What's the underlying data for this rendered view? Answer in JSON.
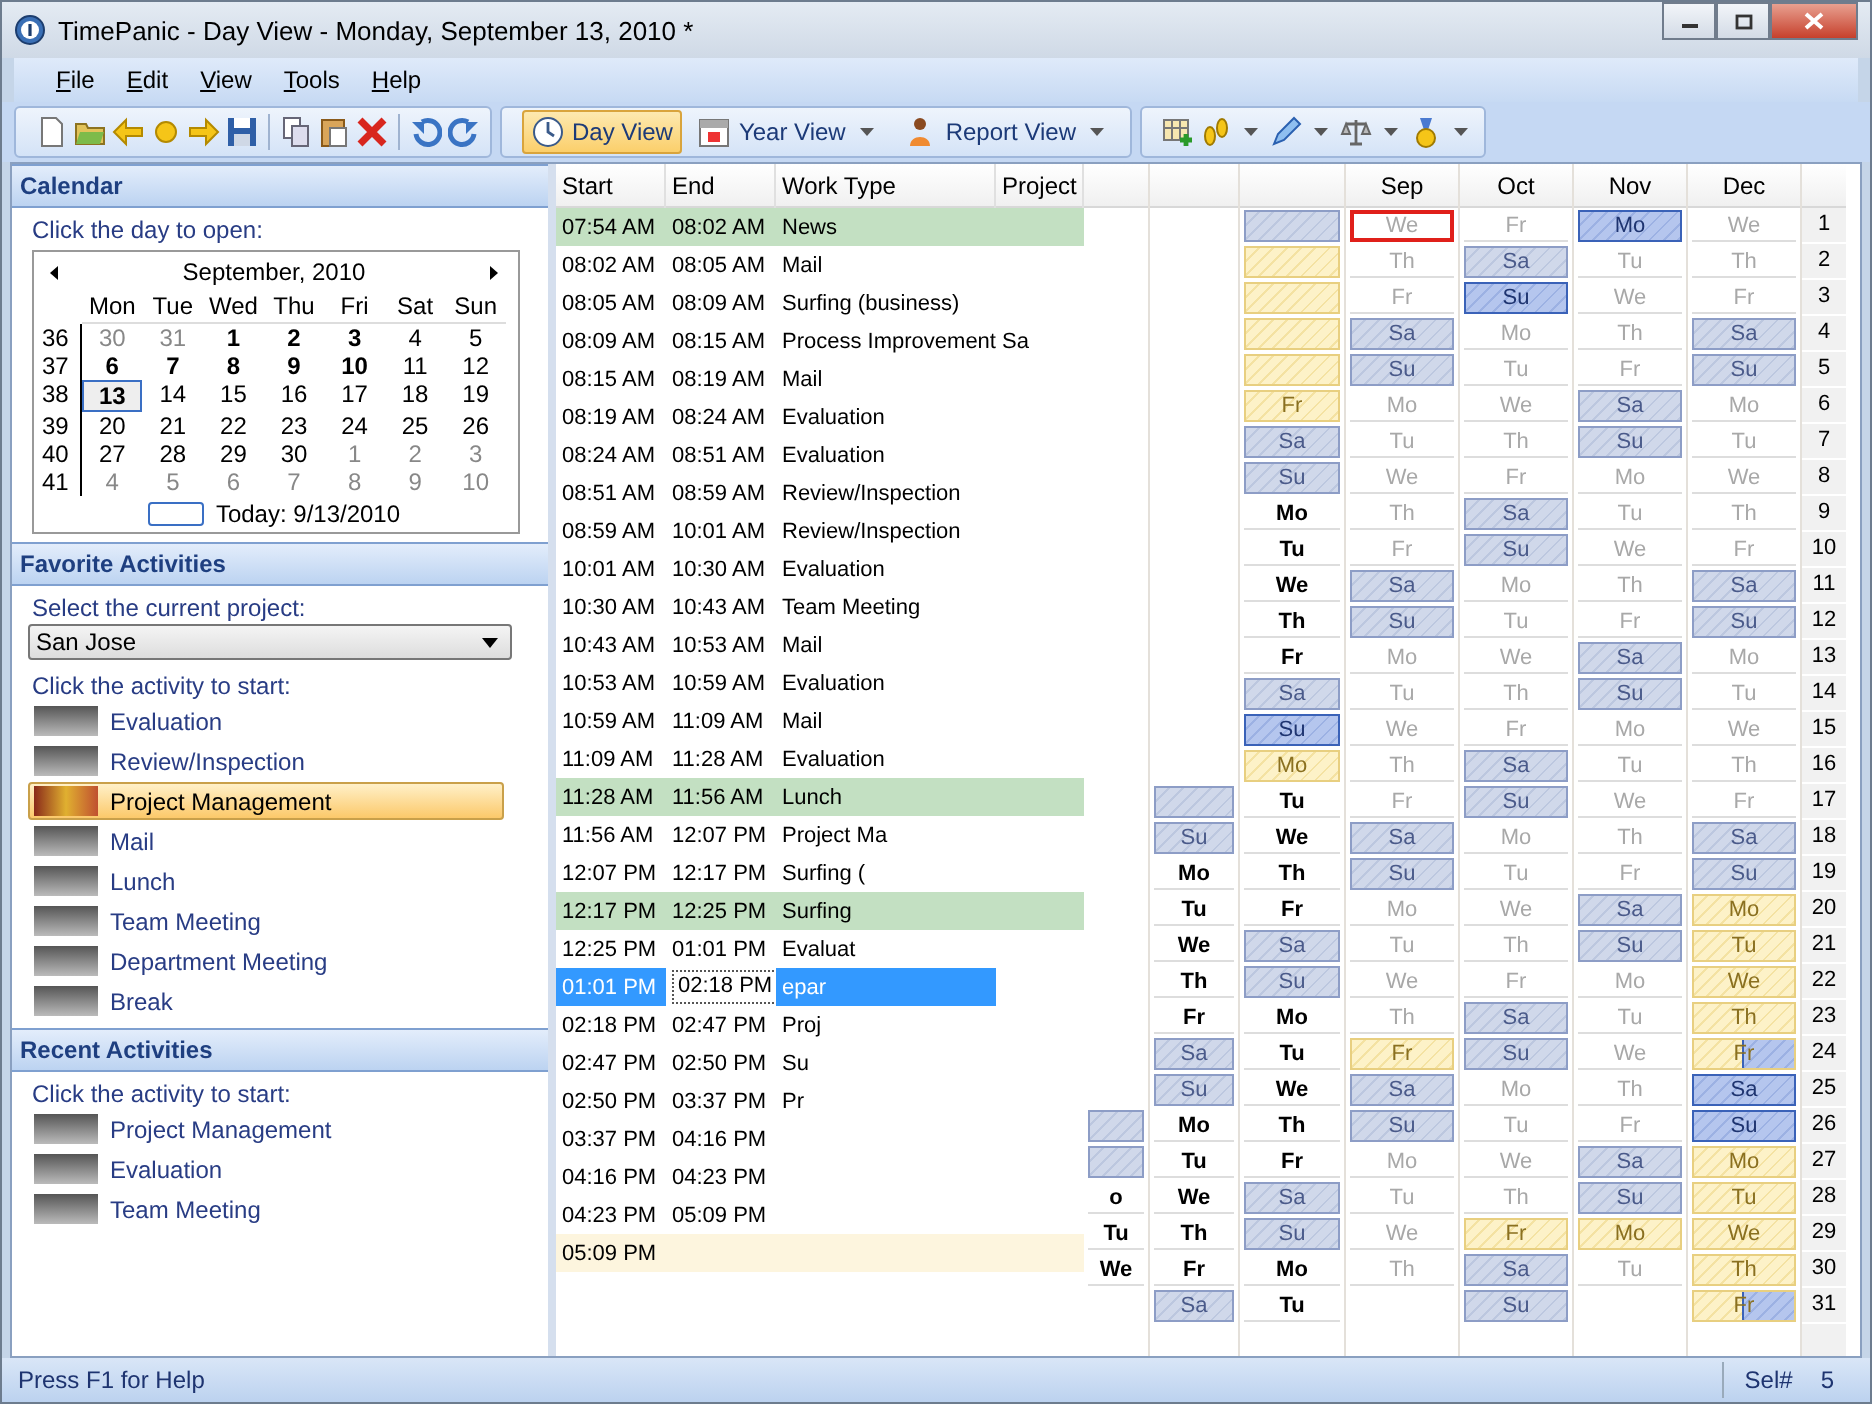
{
  "window": {
    "title": "TimePanic - Day View - Monday, September 13, 2010 *"
  },
  "menu": [
    "File",
    "Edit",
    "View",
    "Tools",
    "Help"
  ],
  "views": [
    {
      "label": "Day View",
      "selected": true,
      "dropdown": false
    },
    {
      "label": "Year View",
      "selected": false,
      "dropdown": true
    },
    {
      "label": "Report View",
      "selected": false,
      "dropdown": true
    }
  ],
  "calendar": {
    "title": "Calendar",
    "prompt": "Click the day to open:",
    "month": "September, 2010",
    "weekdays": [
      "Mon",
      "Tue",
      "Wed",
      "Thu",
      "Fri",
      "Sat",
      "Sun"
    ],
    "weeks": [
      {
        "week": "36",
        "days": [
          {
            "day": "30",
            "kind": "other"
          },
          {
            "day": "31",
            "kind": "other"
          },
          {
            "day": "1",
            "kind": "bold"
          },
          {
            "day": "2",
            "kind": "bold"
          },
          {
            "day": "3",
            "kind": "bold"
          },
          {
            "day": "4",
            "kind": "normal"
          },
          {
            "day": "5",
            "kind": "normal"
          }
        ]
      },
      {
        "week": "37",
        "days": [
          {
            "day": "6",
            "kind": "bold"
          },
          {
            "day": "7",
            "kind": "bold"
          },
          {
            "day": "8",
            "kind": "bold"
          },
          {
            "day": "9",
            "kind": "bold"
          },
          {
            "day": "10",
            "kind": "bold"
          },
          {
            "day": "11",
            "kind": "normal"
          },
          {
            "day": "12",
            "kind": "normal"
          }
        ]
      },
      {
        "week": "38",
        "days": [
          {
            "day": "13",
            "kind": "today"
          },
          {
            "day": "14",
            "kind": "normal"
          },
          {
            "day": "15",
            "kind": "normal"
          },
          {
            "day": "16",
            "kind": "normal"
          },
          {
            "day": "17",
            "kind": "normal"
          },
          {
            "day": "18",
            "kind": "normal"
          },
          {
            "day": "19",
            "kind": "normal"
          }
        ]
      },
      {
        "week": "39",
        "days": [
          {
            "day": "20",
            "kind": "normal"
          },
          {
            "day": "21",
            "kind": "normal"
          },
          {
            "day": "22",
            "kind": "normal"
          },
          {
            "day": "23",
            "kind": "normal"
          },
          {
            "day": "24",
            "kind": "normal"
          },
          {
            "day": "25",
            "kind": "normal"
          },
          {
            "day": "26",
            "kind": "normal"
          }
        ]
      },
      {
        "week": "40",
        "days": [
          {
            "day": "27",
            "kind": "normal"
          },
          {
            "day": "28",
            "kind": "normal"
          },
          {
            "day": "29",
            "kind": "normal"
          },
          {
            "day": "30",
            "kind": "normal"
          },
          {
            "day": "1",
            "kind": "other"
          },
          {
            "day": "2",
            "kind": "other"
          },
          {
            "day": "3",
            "kind": "other"
          }
        ]
      },
      {
        "week": "41",
        "days": [
          {
            "day": "4",
            "kind": "other"
          },
          {
            "day": "5",
            "kind": "other"
          },
          {
            "day": "6",
            "kind": "other"
          },
          {
            "day": "7",
            "kind": "other"
          },
          {
            "day": "8",
            "kind": "other"
          },
          {
            "day": "9",
            "kind": "other"
          },
          {
            "day": "10",
            "kind": "other"
          }
        ]
      }
    ],
    "today": "Today: 9/13/2010"
  },
  "favorites": {
    "title": "Favorite Activities",
    "project_prompt": "Select the current project:",
    "project": "San Jose",
    "activity_prompt": "Click the activity to start:",
    "activities": [
      {
        "label": "Evaluation",
        "selected": false
      },
      {
        "label": "Review/Inspection",
        "selected": false
      },
      {
        "label": "Project Management",
        "selected": true
      },
      {
        "label": "Mail",
        "selected": false
      },
      {
        "label": "Lunch",
        "selected": false
      },
      {
        "label": "Team Meeting",
        "selected": false
      },
      {
        "label": "Department Meeting",
        "selected": false
      },
      {
        "label": "Break",
        "selected": false
      }
    ]
  },
  "recent": {
    "title": "Recent Activities",
    "activity_prompt": "Click the activity to start:",
    "activities": [
      {
        "label": "Project Management",
        "selected": false
      },
      {
        "label": "Evaluation",
        "selected": false
      },
      {
        "label": "Team Meeting",
        "selected": false
      }
    ]
  },
  "day_view": {
    "columns": [
      "Start",
      "End",
      "Work Type",
      "Project"
    ],
    "entries": [
      {
        "start": "07:54 AM",
        "end": "08:02 AM",
        "work_type": "News",
        "kind": "break",
        "selected": false
      },
      {
        "start": "08:02 AM",
        "end": "08:05 AM",
        "work_type": "Mail",
        "kind": "normal",
        "selected": false
      },
      {
        "start": "08:05 AM",
        "end": "08:09 AM",
        "work_type": "Surfing (business)",
        "kind": "normal",
        "selected": false
      },
      {
        "start": "08:09 AM",
        "end": "08:15 AM",
        "work_type": "Process Improvement",
        "project": "Sa",
        "kind": "normal",
        "selected": false
      },
      {
        "start": "08:15 AM",
        "end": "08:19 AM",
        "work_type": "Mail",
        "kind": "normal",
        "selected": false
      },
      {
        "start": "08:19 AM",
        "end": "08:24 AM",
        "work_type": "Evaluation",
        "kind": "normal",
        "selected": false
      },
      {
        "start": "08:24 AM",
        "end": "08:51 AM",
        "work_type": "Evaluation",
        "kind": "normal",
        "selected": false
      },
      {
        "start": "08:51 AM",
        "end": "08:59 AM",
        "work_type": "Review/Inspection",
        "kind": "normal",
        "selected": false
      },
      {
        "start": "08:59 AM",
        "end": "10:01 AM",
        "work_type": "Review/Inspection",
        "kind": "normal",
        "selected": false
      },
      {
        "start": "10:01 AM",
        "end": "10:30 AM",
        "work_type": "Evaluation",
        "kind": "normal",
        "selected": false
      },
      {
        "start": "10:30 AM",
        "end": "10:43 AM",
        "work_type": "Team Meeting",
        "kind": "normal",
        "selected": false
      },
      {
        "start": "10:43 AM",
        "end": "10:53 AM",
        "work_type": "Mail",
        "kind": "normal",
        "selected": false
      },
      {
        "start": "10:53 AM",
        "end": "10:59 AM",
        "work_type": "Evaluation",
        "kind": "normal",
        "selected": false
      },
      {
        "start": "10:59 AM",
        "end": "11:09 AM",
        "work_type": "Mail",
        "kind": "normal",
        "selected": false
      },
      {
        "start": "11:09 AM",
        "end": "11:28 AM",
        "work_type": "Evaluation",
        "kind": "normal",
        "selected": false
      },
      {
        "start": "11:28 AM",
        "end": "11:56 AM",
        "work_type": "Lunch",
        "kind": "break",
        "selected": false
      },
      {
        "start": "11:56 AM",
        "end": "12:07 PM",
        "work_type": "Project Ma",
        "kind": "normal",
        "selected": false
      },
      {
        "start": "12:07 PM",
        "end": "12:17 PM",
        "work_type": "Surfing (",
        "kind": "normal",
        "selected": false
      },
      {
        "start": "12:17 PM",
        "end": "12:25 PM",
        "work_type": "Surfing",
        "kind": "break",
        "selected": false
      },
      {
        "start": "12:25 PM",
        "end": "01:01 PM",
        "work_type": "Evaluat",
        "kind": "normal",
        "selected": false
      },
      {
        "start": "01:01 PM",
        "end": "02:18 PM",
        "work_type": "epar",
        "kind": "normal",
        "selected": true
      },
      {
        "start": "02:18 PM",
        "end": "02:47 PM",
        "work_type": "Proj",
        "kind": "normal",
        "selected": false
      },
      {
        "start": "02:47 PM",
        "end": "02:50 PM",
        "work_type": "Su",
        "kind": "normal",
        "selected": false
      },
      {
        "start": "02:50 PM",
        "end": "03:37 PM",
        "work_type": "Pr",
        "kind": "normal",
        "selected": false
      },
      {
        "start": "03:37 PM",
        "end": "04:16 PM",
        "kind": "normal",
        "selected": false
      },
      {
        "start": "04:16 PM",
        "end": "04:23 PM",
        "kind": "normal",
        "selected": false
      },
      {
        "start": "04:23 PM",
        "end": "05:09 PM",
        "kind": "normal",
        "selected": false
      },
      {
        "start": "05:09 PM",
        "kind": "running",
        "selected": false
      }
    ]
  },
  "year_view": {
    "months": [
      {
        "cells": [
          null,
          null,
          null,
          null,
          null,
          null,
          null,
          null,
          null,
          null,
          null,
          null,
          null,
          null,
          null,
          null,
          null,
          null,
          null,
          null,
          null,
          null,
          null,
          null,
          null,
          {
            "kind": "weekend"
          },
          {
            "kind": "weekend"
          },
          {
            "day": "o",
            "kind": "bold"
          },
          {
            "day": "Tu",
            "kind": "bold"
          },
          {
            "day": "We",
            "kind": "bold"
          },
          null
        ]
      },
      {
        "cells": [
          null,
          null,
          null,
          null,
          null,
          null,
          null,
          null,
          null,
          null,
          null,
          null,
          null,
          null,
          null,
          null,
          {
            "kind": "weekend"
          },
          {
            "day": "Su",
            "kind": "weekend"
          },
          {
            "day": "Mo",
            "kind": "bold"
          },
          {
            "day": "Tu",
            "kind": "bold"
          },
          {
            "day": "We",
            "kind": "bold"
          },
          {
            "day": "Th",
            "kind": "bold"
          },
          {
            "day": "Fr",
            "kind": "bold"
          },
          {
            "day": "Sa",
            "kind": "weekend"
          },
          {
            "day": "Su",
            "kind": "weekend"
          },
          {
            "day": "Mo",
            "kind": "bold"
          },
          {
            "day": "Tu",
            "kind": "bold"
          },
          {
            "day": "We",
            "kind": "bold"
          },
          {
            "day": "Th",
            "kind": "bold"
          },
          {
            "day": "Fr",
            "kind": "bold"
          },
          {
            "day": "Sa",
            "kind": "weekend"
          }
        ]
      },
      {
        "cells": [
          {
            "kind": "weekend"
          },
          {
            "kind": "vacation"
          },
          {
            "kind": "vacation"
          },
          {
            "kind": "vacation"
          },
          {
            "kind": "vacation"
          },
          {
            "day": "Fr",
            "kind": "vacation"
          },
          {
            "day": "Sa",
            "kind": "weekend"
          },
          {
            "day": "Su",
            "kind": "weekend"
          },
          {
            "day": "Mo",
            "kind": "bold"
          },
          {
            "day": "Tu",
            "kind": "bold"
          },
          {
            "day": "We",
            "kind": "bold"
          },
          {
            "day": "Th",
            "kind": "bold"
          },
          {
            "day": "Fr",
            "kind": "bold"
          },
          {
            "day": "Sa",
            "kind": "weekend"
          },
          {
            "day": "Su",
            "kind": "highlight"
          },
          {
            "day": "Mo",
            "kind": "vacation"
          },
          {
            "day": "Tu",
            "kind": "bold"
          },
          {
            "day": "We",
            "kind": "bold"
          },
          {
            "day": "Th",
            "kind": "bold"
          },
          {
            "day": "Fr",
            "kind": "bold"
          },
          {
            "day": "Sa",
            "kind": "weekend"
          },
          {
            "day": "Su",
            "kind": "weekend"
          },
          {
            "day": "Mo",
            "kind": "bold"
          },
          {
            "day": "Tu",
            "kind": "bold"
          },
          {
            "day": "We",
            "kind": "bold"
          },
          {
            "day": "Th",
            "kind": "bold"
          },
          {
            "day": "Fr",
            "kind": "bold"
          },
          {
            "day": "Sa",
            "kind": "weekend"
          },
          {
            "day": "Su",
            "kind": "weekend"
          },
          {
            "day": "Mo",
            "kind": "bold"
          },
          {
            "day": "Tu",
            "kind": "bold"
          }
        ]
      },
      {
        "name": "Sep",
        "cells": [
          {
            "day": "We",
            "kind": "today"
          },
          {
            "day": "Th",
            "kind": "plain"
          },
          {
            "day": "Fr",
            "kind": "plain"
          },
          {
            "day": "Sa",
            "kind": "weekend"
          },
          {
            "day": "Su",
            "kind": "weekend"
          },
          {
            "day": "Mo",
            "kind": "plain"
          },
          {
            "day": "Tu",
            "kind": "plain"
          },
          {
            "day": "We",
            "kind": "plain"
          },
          {
            "day": "Th",
            "kind": "plain"
          },
          {
            "day": "Fr",
            "kind": "plain"
          },
          {
            "day": "Sa",
            "kind": "weekend"
          },
          {
            "day": "Su",
            "kind": "weekend"
          },
          {
            "day": "Mo",
            "kind": "plain"
          },
          {
            "day": "Tu",
            "kind": "plain"
          },
          {
            "day": "We",
            "kind": "plain"
          },
          {
            "day": "Th",
            "kind": "plain"
          },
          {
            "day": "Fr",
            "kind": "plain"
          },
          {
            "day": "Sa",
            "kind": "weekend"
          },
          {
            "day": "Su",
            "kind": "weekend"
          },
          {
            "day": "Mo",
            "kind": "plain"
          },
          {
            "day": "Tu",
            "kind": "plain"
          },
          {
            "day": "We",
            "kind": "plain"
          },
          {
            "day": "Th",
            "kind": "plain"
          },
          {
            "day": "Fr",
            "kind": "vacation"
          },
          {
            "day": "Sa",
            "kind": "weekend"
          },
          {
            "day": "Su",
            "kind": "weekend"
          },
          {
            "day": "Mo",
            "kind": "plain"
          },
          {
            "day": "Tu",
            "kind": "plain"
          },
          {
            "day": "We",
            "kind": "plain"
          },
          {
            "day": "Th",
            "kind": "plain"
          },
          null
        ]
      },
      {
        "name": "Oct",
        "cells": [
          {
            "day": "Fr",
            "kind": "plain"
          },
          {
            "day": "Sa",
            "kind": "weekend"
          },
          {
            "day": "Su",
            "kind": "highlight"
          },
          {
            "day": "Mo",
            "kind": "plain"
          },
          {
            "day": "Tu",
            "kind": "plain"
          },
          {
            "day": "We",
            "kind": "plain"
          },
          {
            "day": "Th",
            "kind": "plain"
          },
          {
            "day": "Fr",
            "kind": "plain"
          },
          {
            "day": "Sa",
            "kind": "weekend"
          },
          {
            "day": "Su",
            "kind": "weekend"
          },
          {
            "day": "Mo",
            "kind": "plain"
          },
          {
            "day": "Tu",
            "kind": "plain"
          },
          {
            "day": "We",
            "kind": "plain"
          },
          {
            "day": "Th",
            "kind": "plain"
          },
          {
            "day": "Fr",
            "kind": "plain"
          },
          {
            "day": "Sa",
            "kind": "weekend"
          },
          {
            "day": "Su",
            "kind": "weekend"
          },
          {
            "day": "Mo",
            "kind": "plain"
          },
          {
            "day": "Tu",
            "kind": "plain"
          },
          {
            "day": "We",
            "kind": "plain"
          },
          {
            "day": "Th",
            "kind": "plain"
          },
          {
            "day": "Fr",
            "kind": "plain"
          },
          {
            "day": "Sa",
            "kind": "weekend"
          },
          {
            "day": "Su",
            "kind": "weekend"
          },
          {
            "day": "Mo",
            "kind": "plain"
          },
          {
            "day": "Tu",
            "kind": "plain"
          },
          {
            "day": "We",
            "kind": "plain"
          },
          {
            "day": "Th",
            "kind": "plain"
          },
          {
            "day": "Fr",
            "kind": "vacation"
          },
          {
            "day": "Sa",
            "kind": "weekend"
          },
          {
            "day": "Su",
            "kind": "weekend"
          }
        ]
      },
      {
        "name": "Nov",
        "cells": [
          {
            "day": "Mo",
            "kind": "highlight"
          },
          {
            "day": "Tu",
            "kind": "plain"
          },
          {
            "day": "We",
            "kind": "plain"
          },
          {
            "day": "Th",
            "kind": "plain"
          },
          {
            "day": "Fr",
            "kind": "plain"
          },
          {
            "day": "Sa",
            "kind": "weekend"
          },
          {
            "day": "Su",
            "kind": "weekend"
          },
          {
            "day": "Mo",
            "kind": "plain"
          },
          {
            "day": "Tu",
            "kind": "plain"
          },
          {
            "day": "We",
            "kind": "plain"
          },
          {
            "day": "Th",
            "kind": "plain"
          },
          {
            "day": "Fr",
            "kind": "plain"
          },
          {
            "day": "Sa",
            "kind": "weekend"
          },
          {
            "day": "Su",
            "kind": "weekend"
          },
          {
            "day": "Mo",
            "kind": "plain"
          },
          {
            "day": "Tu",
            "kind": "plain"
          },
          {
            "day": "We",
            "kind": "plain"
          },
          {
            "day": "Th",
            "kind": "plain"
          },
          {
            "day": "Fr",
            "kind": "plain"
          },
          {
            "day": "Sa",
            "kind": "weekend"
          },
          {
            "day": "Su",
            "kind": "weekend"
          },
          {
            "day": "Mo",
            "kind": "plain"
          },
          {
            "day": "Tu",
            "kind": "plain"
          },
          {
            "day": "We",
            "kind": "plain"
          },
          {
            "day": "Th",
            "kind": "plain"
          },
          {
            "day": "Fr",
            "kind": "plain"
          },
          {
            "day": "Sa",
            "kind": "weekend"
          },
          {
            "day": "Su",
            "kind": "weekend"
          },
          {
            "day": "Mo",
            "kind": "vacation"
          },
          {
            "day": "Tu",
            "kind": "plain"
          },
          null
        ]
      },
      {
        "name": "Dec",
        "cells": [
          {
            "day": "We",
            "kind": "plain"
          },
          {
            "day": "Th",
            "kind": "plain"
          },
          {
            "day": "Fr",
            "kind": "plain"
          },
          {
            "day": "Sa",
            "kind": "weekend"
          },
          {
            "day": "Su",
            "kind": "weekend"
          },
          {
            "day": "Mo",
            "kind": "plain"
          },
          {
            "day": "Tu",
            "kind": "plain"
          },
          {
            "day": "We",
            "kind": "plain"
          },
          {
            "day": "Th",
            "kind": "plain"
          },
          {
            "day": "Fr",
            "kind": "plain"
          },
          {
            "day": "Sa",
            "kind": "weekend"
          },
          {
            "day": "Su",
            "kind": "weekend"
          },
          {
            "day": "Mo",
            "kind": "plain"
          },
          {
            "day": "Tu",
            "kind": "plain"
          },
          {
            "day": "We",
            "kind": "plain"
          },
          {
            "day": "Th",
            "kind": "plain"
          },
          {
            "day": "Fr",
            "kind": "plain"
          },
          {
            "day": "Sa",
            "kind": "weekend"
          },
          {
            "day": "Su",
            "kind": "weekend"
          },
          {
            "day": "Mo",
            "kind": "vacation"
          },
          {
            "day": "Tu",
            "kind": "vacation"
          },
          {
            "day": "We",
            "kind": "vacation"
          },
          {
            "day": "Th",
            "kind": "vacation"
          },
          {
            "day": "Fr",
            "kind": "half"
          },
          {
            "day": "Sa",
            "kind": "highlight"
          },
          {
            "day": "Su",
            "kind": "highlight"
          },
          {
            "day": "Mo",
            "kind": "vacation"
          },
          {
            "day": "Tu",
            "kind": "vacation"
          },
          {
            "day": "We",
            "kind": "vacation"
          },
          {
            "day": "Th",
            "kind": "vacation"
          },
          {
            "day": "Fr",
            "kind": "half"
          }
        ]
      }
    ],
    "row_numbers": [
      "1",
      "2",
      "3",
      "4",
      "5",
      "6",
      "7",
      "8",
      "9",
      "10",
      "11",
      "12",
      "13",
      "14",
      "15",
      "16",
      "17",
      "18",
      "19",
      "20",
      "21",
      "22",
      "23",
      "24",
      "25",
      "26",
      "27",
      "28",
      "29",
      "30",
      "31"
    ]
  },
  "status_bar": {
    "help": "Press F1 for Help",
    "label": "Sel#",
    "value": "5"
  }
}
